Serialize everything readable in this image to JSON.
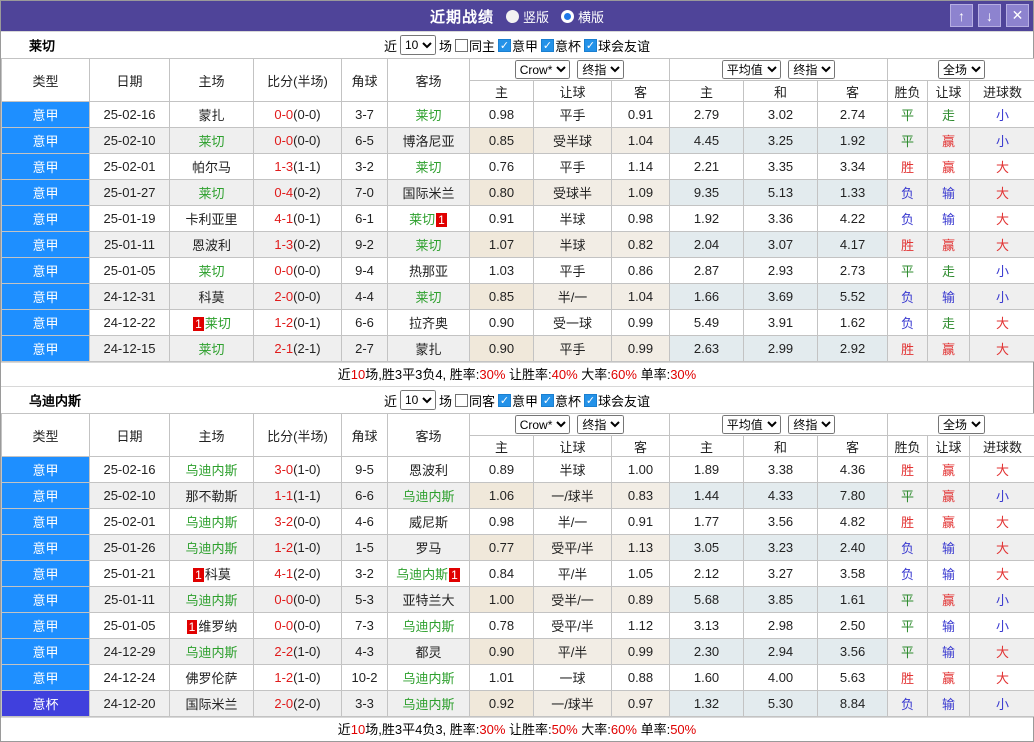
{
  "titlebar": {
    "title": "近期战绩",
    "vertical_label": "竖版",
    "horizontal_label": "横版",
    "selected": "横版",
    "up_icon": "↑",
    "down_icon": "↓",
    "close_icon": "✕"
  },
  "colors": {
    "titlebar_purple": "#4f4499",
    "serie_a_blue": "#1e8fff",
    "coppa_italia_blue": "#4040dd",
    "team_green": "#2da02d",
    "win_red": "#e23333",
    "draw_green": "#2e8b2e",
    "lose_blue": "#3a3ad0",
    "score_red": "#e01b1b"
  },
  "filter_labels": {
    "near": "近",
    "games": "场",
    "leagues": [
      "意甲",
      "意杯",
      "球会友谊"
    ]
  },
  "table_header": {
    "main": [
      "类型",
      "日期",
      "主场",
      "比分(半场)",
      "角球",
      "客场"
    ],
    "sub": [
      "主",
      "让球",
      "客",
      "主",
      "和",
      "客",
      "胜负",
      "让球",
      "进球数"
    ],
    "selects": {
      "crow": "Crow*",
      "final_a": "终指",
      "avg": "平均值",
      "final_b": "终指",
      "full": "全场"
    }
  },
  "sections": [
    {
      "team": "莱切",
      "count": "10",
      "same_label": "同主",
      "checks": {
        "same": false,
        "league1": true,
        "league2": true,
        "league3": true
      },
      "rows": [
        {
          "league": "意甲",
          "date": "25-02-16",
          "home": "蒙扎",
          "home_green": false,
          "score": "0-0",
          "half": "(0-0)",
          "corner": "3-7",
          "away": "莱切",
          "away_green": true,
          "crow": [
            "0.98",
            "平手",
            "0.91"
          ],
          "avg": [
            "2.79",
            "3.02",
            "2.74"
          ],
          "results": [
            "平",
            "走",
            "小"
          ]
        },
        {
          "league": "意甲",
          "date": "25-02-10",
          "home": "莱切",
          "home_green": true,
          "score": "0-0",
          "half": "(0-0)",
          "corner": "6-5",
          "away": "博洛尼亚",
          "away_green": false,
          "crow": [
            "0.85",
            "受半球",
            "1.04"
          ],
          "avg": [
            "4.45",
            "3.25",
            "1.92"
          ],
          "results": [
            "平",
            "赢",
            "小"
          ]
        },
        {
          "league": "意甲",
          "date": "25-02-01",
          "home": "帕尔马",
          "home_green": false,
          "score": "1-3",
          "half": "(1-1)",
          "corner": "3-2",
          "away": "莱切",
          "away_green": true,
          "crow": [
            "0.76",
            "平手",
            "1.14"
          ],
          "avg": [
            "2.21",
            "3.35",
            "3.34"
          ],
          "results": [
            "胜",
            "赢",
            "大"
          ]
        },
        {
          "league": "意甲",
          "date": "25-01-27",
          "home": "莱切",
          "home_green": true,
          "score": "0-4",
          "half": "(0-2)",
          "corner": "7-0",
          "away": "国际米兰",
          "away_green": false,
          "crow": [
            "0.80",
            "受球半",
            "1.09"
          ],
          "avg": [
            "9.35",
            "5.13",
            "1.33"
          ],
          "results": [
            "负",
            "输",
            "大"
          ]
        },
        {
          "league": "意甲",
          "date": "25-01-19",
          "home": "卡利亚里",
          "home_green": false,
          "score": "4-1",
          "half": "(0-1)",
          "corner": "6-1",
          "away": "莱切",
          "away_green": true,
          "away_badge_after": "1",
          "crow": [
            "0.91",
            "半球",
            "0.98"
          ],
          "avg": [
            "1.92",
            "3.36",
            "4.22"
          ],
          "results": [
            "负",
            "输",
            "大"
          ]
        },
        {
          "league": "意甲",
          "date": "25-01-11",
          "home": "恩波利",
          "home_green": false,
          "score": "1-3",
          "half": "(0-2)",
          "corner": "9-2",
          "away": "莱切",
          "away_green": true,
          "crow": [
            "1.07",
            "半球",
            "0.82"
          ],
          "avg": [
            "2.04",
            "3.07",
            "4.17"
          ],
          "results": [
            "胜",
            "赢",
            "大"
          ]
        },
        {
          "league": "意甲",
          "date": "25-01-05",
          "home": "莱切",
          "home_green": true,
          "score": "0-0",
          "half": "(0-0)",
          "corner": "9-4",
          "away": "热那亚",
          "away_green": false,
          "crow": [
            "1.03",
            "平手",
            "0.86"
          ],
          "avg": [
            "2.87",
            "2.93",
            "2.73"
          ],
          "results": [
            "平",
            "走",
            "小"
          ]
        },
        {
          "league": "意甲",
          "date": "24-12-31",
          "home": "科莫",
          "home_green": false,
          "score": "2-0",
          "half": "(0-0)",
          "corner": "4-4",
          "away": "莱切",
          "away_green": true,
          "crow": [
            "0.85",
            "半/一",
            "1.04"
          ],
          "avg": [
            "1.66",
            "3.69",
            "5.52"
          ],
          "results": [
            "负",
            "输",
            "小"
          ]
        },
        {
          "league": "意甲",
          "date": "24-12-22",
          "home": "莱切",
          "home_green": true,
          "home_badge_before": "1",
          "score": "1-2",
          "half": "(0-1)",
          "corner": "6-6",
          "away": "拉齐奥",
          "away_green": false,
          "crow": [
            "0.90",
            "受一球",
            "0.99"
          ],
          "avg": [
            "5.49",
            "3.91",
            "1.62"
          ],
          "results": [
            "负",
            "走",
            "大"
          ]
        },
        {
          "league": "意甲",
          "date": "24-12-15",
          "home": "莱切",
          "home_green": true,
          "score": "2-1",
          "half": "(2-1)",
          "corner": "2-7",
          "away": "蒙扎",
          "away_green": false,
          "crow": [
            "0.90",
            "平手",
            "0.99"
          ],
          "avg": [
            "2.63",
            "2.99",
            "2.92"
          ],
          "results": [
            "胜",
            "赢",
            "大"
          ]
        }
      ],
      "summary": [
        {
          "text": "近",
          "red": false
        },
        {
          "text": "10",
          "red": true
        },
        {
          "text": "场,胜3平3负4, 胜率:",
          "red": false
        },
        {
          "text": "30%",
          "red": true
        },
        {
          "text": " 让胜率:",
          "red": false
        },
        {
          "text": "40%",
          "red": true
        },
        {
          "text": " 大率:",
          "red": false
        },
        {
          "text": "60%",
          "red": true
        },
        {
          "text": " 单率:",
          "red": false
        },
        {
          "text": "30%",
          "red": true
        }
      ]
    },
    {
      "team": "乌迪内斯",
      "count": "10",
      "same_label": "同客",
      "checks": {
        "same": false,
        "league1": true,
        "league2": true,
        "league3": true
      },
      "rows": [
        {
          "league": "意甲",
          "date": "25-02-16",
          "home": "乌迪内斯",
          "home_green": true,
          "score": "3-0",
          "half": "(1-0)",
          "corner": "9-5",
          "away": "恩波利",
          "away_green": false,
          "crow": [
            "0.89",
            "半球",
            "1.00"
          ],
          "avg": [
            "1.89",
            "3.38",
            "4.36"
          ],
          "results": [
            "胜",
            "赢",
            "大"
          ]
        },
        {
          "league": "意甲",
          "date": "25-02-10",
          "home": "那不勒斯",
          "home_green": false,
          "score": "1-1",
          "half": "(1-1)",
          "corner": "6-6",
          "away": "乌迪内斯",
          "away_green": true,
          "crow": [
            "1.06",
            "一/球半",
            "0.83"
          ],
          "avg": [
            "1.44",
            "4.33",
            "7.80"
          ],
          "results": [
            "平",
            "赢",
            "小"
          ]
        },
        {
          "league": "意甲",
          "date": "25-02-01",
          "home": "乌迪内斯",
          "home_green": true,
          "score": "3-2",
          "half": "(0-0)",
          "corner": "4-6",
          "away": "威尼斯",
          "away_green": false,
          "crow": [
            "0.98",
            "半/一",
            "0.91"
          ],
          "avg": [
            "1.77",
            "3.56",
            "4.82"
          ],
          "results": [
            "胜",
            "赢",
            "大"
          ]
        },
        {
          "league": "意甲",
          "date": "25-01-26",
          "home": "乌迪内斯",
          "home_green": true,
          "score": "1-2",
          "half": "(1-0)",
          "corner": "1-5",
          "away": "罗马",
          "away_green": false,
          "crow": [
            "0.77",
            "受平/半",
            "1.13"
          ],
          "avg": [
            "3.05",
            "3.23",
            "2.40"
          ],
          "results": [
            "负",
            "输",
            "大"
          ]
        },
        {
          "league": "意甲",
          "date": "25-01-21",
          "home": "科莫",
          "home_green": false,
          "home_badge_before": "1",
          "score": "4-1",
          "half": "(2-0)",
          "corner": "3-2",
          "away": "乌迪内斯",
          "away_green": true,
          "away_badge_after": "1",
          "crow": [
            "0.84",
            "平/半",
            "1.05"
          ],
          "avg": [
            "2.12",
            "3.27",
            "3.58"
          ],
          "results": [
            "负",
            "输",
            "大"
          ]
        },
        {
          "league": "意甲",
          "date": "25-01-11",
          "home": "乌迪内斯",
          "home_green": true,
          "score": "0-0",
          "half": "(0-0)",
          "corner": "5-3",
          "away": "亚特兰大",
          "away_green": false,
          "crow": [
            "1.00",
            "受半/一",
            "0.89"
          ],
          "avg": [
            "5.68",
            "3.85",
            "1.61"
          ],
          "results": [
            "平",
            "赢",
            "小"
          ]
        },
        {
          "league": "意甲",
          "date": "25-01-05",
          "home": "维罗纳",
          "home_green": false,
          "home_badge_before": "1",
          "score": "0-0",
          "half": "(0-0)",
          "corner": "7-3",
          "away": "乌迪内斯",
          "away_green": true,
          "crow": [
            "0.78",
            "受平/半",
            "1.12"
          ],
          "avg": [
            "3.13",
            "2.98",
            "2.50"
          ],
          "results": [
            "平",
            "输",
            "小"
          ]
        },
        {
          "league": "意甲",
          "date": "24-12-29",
          "home": "乌迪内斯",
          "home_green": true,
          "score": "2-2",
          "half": "(1-0)",
          "corner": "4-3",
          "away": "都灵",
          "away_green": false,
          "crow": [
            "0.90",
            "平/半",
            "0.99"
          ],
          "avg": [
            "2.30",
            "2.94",
            "3.56"
          ],
          "results": [
            "平",
            "输",
            "大"
          ]
        },
        {
          "league": "意甲",
          "date": "24-12-24",
          "home": "佛罗伦萨",
          "home_green": false,
          "score": "1-2",
          "half": "(1-0)",
          "corner": "10-2",
          "away": "乌迪内斯",
          "away_green": true,
          "crow": [
            "1.01",
            "一球",
            "0.88"
          ],
          "avg": [
            "1.60",
            "4.00",
            "5.63"
          ],
          "results": [
            "胜",
            "赢",
            "大"
          ]
        },
        {
          "league": "意杯",
          "date": "24-12-20",
          "home": "国际米兰",
          "home_green": false,
          "score": "2-0",
          "half": "(2-0)",
          "corner": "3-3",
          "away": "乌迪内斯",
          "away_green": true,
          "crow": [
            "0.92",
            "一/球半",
            "0.97"
          ],
          "avg": [
            "1.32",
            "5.30",
            "8.84"
          ],
          "results": [
            "负",
            "输",
            "小"
          ]
        }
      ],
      "summary": [
        {
          "text": "近",
          "red": false
        },
        {
          "text": "10",
          "red": true
        },
        {
          "text": "场,胜3平4负3, 胜率:",
          "red": false
        },
        {
          "text": "30%",
          "red": true
        },
        {
          "text": " 让胜率:",
          "red": false
        },
        {
          "text": "50%",
          "red": true
        },
        {
          "text": " 大率:",
          "red": false
        },
        {
          "text": "60%",
          "red": true
        },
        {
          "text": " 单率:",
          "red": false
        },
        {
          "text": "50%",
          "red": true
        }
      ]
    }
  ]
}
